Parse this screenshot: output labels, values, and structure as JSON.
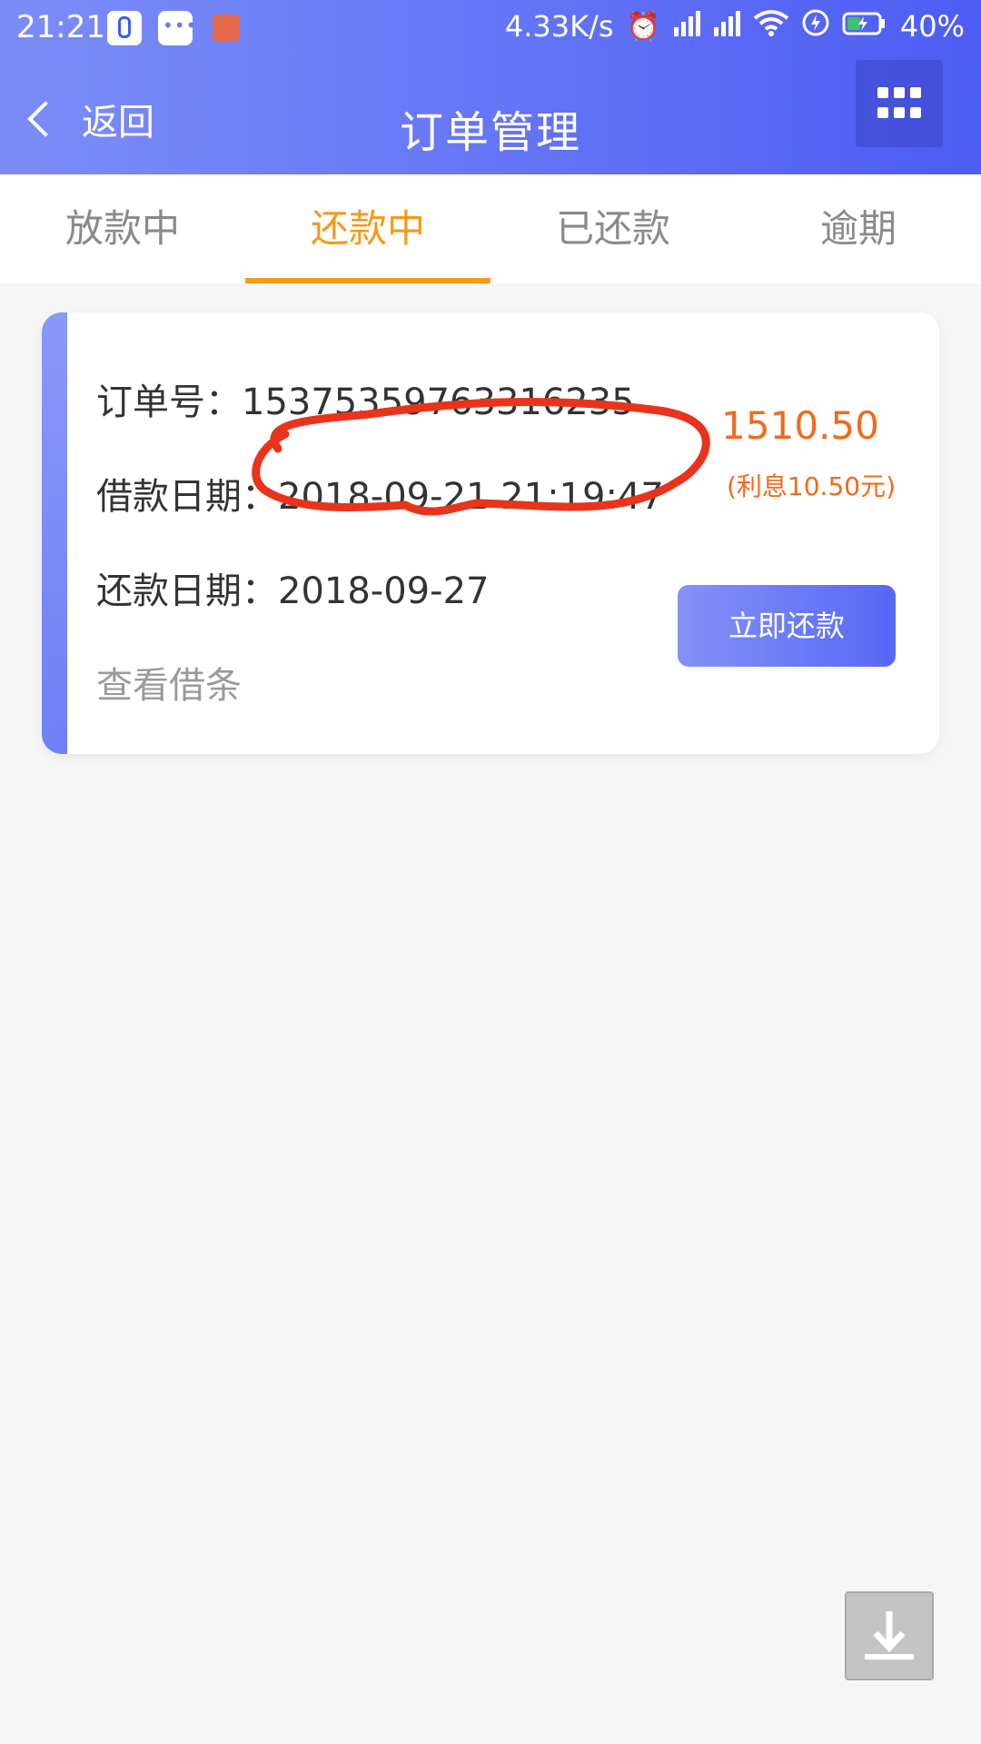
{
  "status_bar": {
    "time": "21:21",
    "network_speed": "4.33K/s",
    "battery": "40%",
    "icons": [
      "app-icon",
      "message-icon",
      "mi-icon",
      "alarm-icon",
      "signal-icon",
      "signal-icon",
      "wifi-icon",
      "bolt-icon",
      "battery-icon"
    ]
  },
  "header": {
    "back_label": "返回",
    "title": "订单管理",
    "menu_icon": "grid-icon"
  },
  "tabs": [
    {
      "label": "放款中",
      "active": false
    },
    {
      "label": "还款中",
      "active": true
    },
    {
      "label": "已还款",
      "active": false
    },
    {
      "label": "逾期",
      "active": false
    }
  ],
  "order": {
    "order_no_label": "订单号：",
    "order_no": "15375359763316235",
    "loan_date_label": "借款日期：",
    "loan_date": "2018-09-21 21:19:47",
    "repay_date_label": "还款日期：",
    "repay_date": "2018-09-27",
    "view_note": "查看借条",
    "amount": "1510.50",
    "interest": "(利息10.50元)",
    "pay_button": "立即还款"
  },
  "colors": {
    "header_gradient_start": "#7c8df8",
    "header_gradient_end": "#4d5cf3",
    "active_tab": "#f59a1b",
    "amount": "#f26a1b",
    "annotation": "#e8341c"
  },
  "floating": {
    "download_icon": "download-icon"
  }
}
